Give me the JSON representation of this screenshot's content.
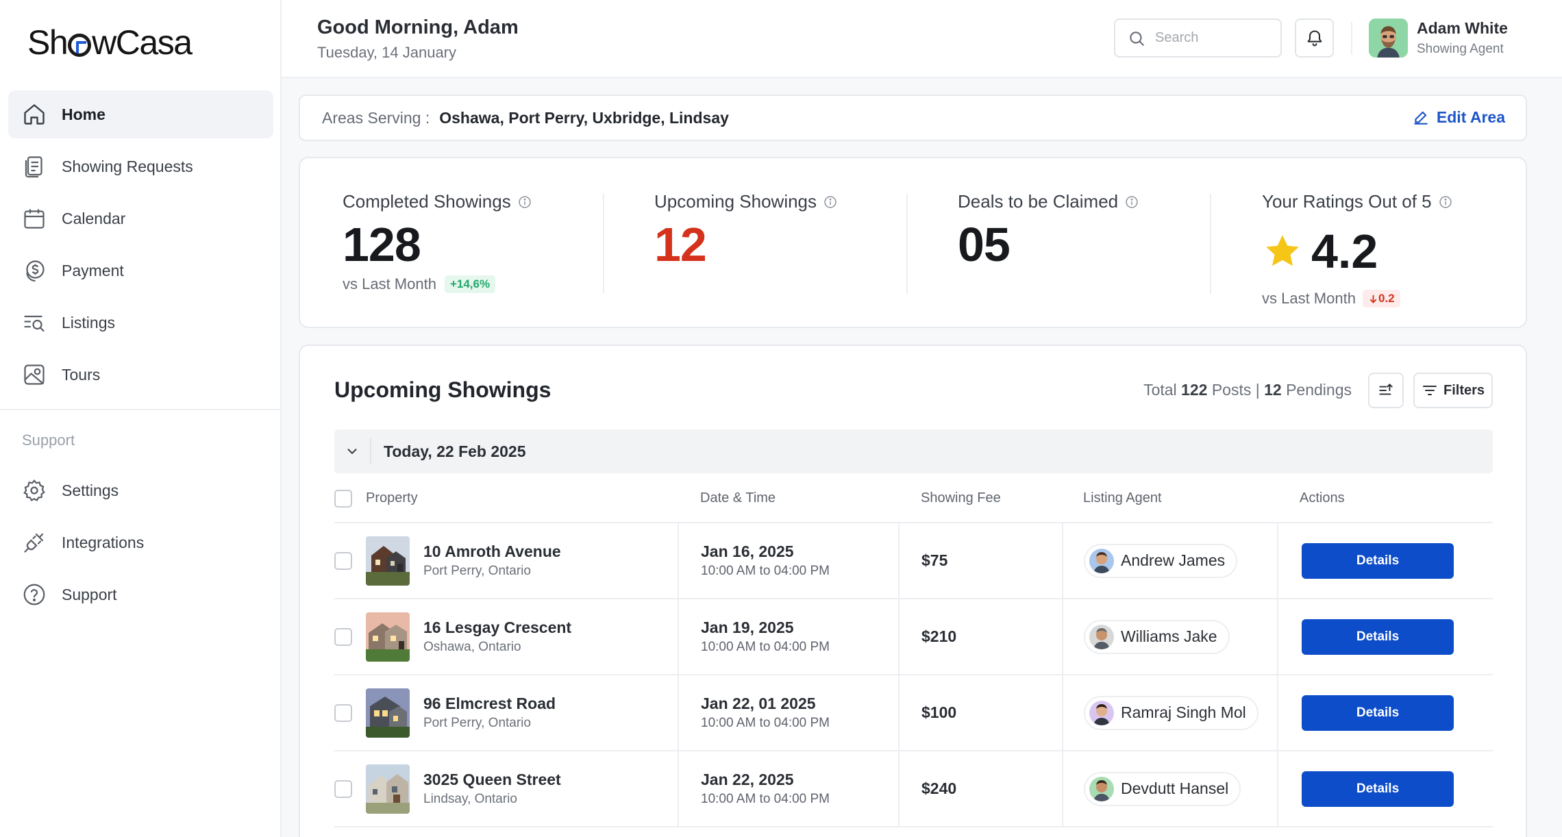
{
  "app": {
    "logo": "ShowCasa"
  },
  "sidebar": {
    "items": [
      {
        "label": "Home",
        "icon": "home-icon",
        "active": true
      },
      {
        "label": "Showing Requests",
        "icon": "document-icon"
      },
      {
        "label": "Calendar",
        "icon": "calendar-icon"
      },
      {
        "label": "Payment",
        "icon": "dollar-coin-icon"
      },
      {
        "label": "Listings",
        "icon": "list-search-icon"
      },
      {
        "label": "Tours",
        "icon": "map-pin-icon"
      }
    ],
    "section_label": "Support",
    "support_items": [
      {
        "label": "Settings",
        "icon": "gear-icon"
      },
      {
        "label": "Integrations",
        "icon": "plug-icon"
      },
      {
        "label": "Support",
        "icon": "help-circle-icon"
      }
    ]
  },
  "header": {
    "greeting": "Good Morning, Adam",
    "date": "Tuesday, 14 January",
    "search_placeholder": "Search",
    "user_name": "Adam White",
    "user_role": "Showing Agent"
  },
  "areas": {
    "label": "Areas Serving :",
    "value": "Oshawa, Port Perry, Uxbridge, Lindsay",
    "edit_label": "Edit Area"
  },
  "stats": {
    "completed": {
      "title": "Completed Showings",
      "value": "128",
      "compare": "vs Last Month",
      "change": "+14,6%"
    },
    "upcoming": {
      "title": "Upcoming Showings",
      "value": "12"
    },
    "deals": {
      "title": "Deals to be Claimed",
      "value": "05"
    },
    "rating": {
      "title": "Your Ratings Out of 5",
      "value": "4.2",
      "compare": "vs Last Month",
      "change": "0.2"
    }
  },
  "showings": {
    "title": "Upcoming Showings",
    "total_prefix": "Total",
    "total_count": "122",
    "total_posts_label": "Posts |",
    "pending_count": "12",
    "pending_label": "Pendings",
    "filters_label": "Filters",
    "group_label": "Today, 22 Feb 2025",
    "columns": [
      "Property",
      "Date & Time",
      "Showing Fee",
      "Listing Agent",
      "Actions"
    ],
    "action_label": "Details",
    "rows": [
      {
        "name": "10 Amroth Avenue",
        "location": "Port Perry, Ontario",
        "date": "Jan 16, 2025",
        "time": "10:00 AM to 04:00 PM",
        "fee": "$75",
        "agent": "Andrew James"
      },
      {
        "name": "16 Lesgay Crescent",
        "location": "Oshawa, Ontario",
        "date": "Jan 19, 2025",
        "time": "10:00 AM to 04:00 PM",
        "fee": "$210",
        "agent": "Williams Jake"
      },
      {
        "name": "96 Elmcrest Road",
        "location": "Port Perry, Ontario",
        "date": "Jan 22, 01 2025",
        "time": "10:00 AM to 04:00 PM",
        "fee": "$100",
        "agent": "Ramraj Singh Mol"
      },
      {
        "name": "3025 Queen Street",
        "location": "Lindsay, Ontario",
        "date": "Jan 22, 2025",
        "time": "10:00 AM to 04:00 PM",
        "fee": "$240",
        "agent": "Devdutt Hansel"
      }
    ]
  },
  "colors": {
    "primary": "#0d4dc9",
    "link": "#1d55c8",
    "upcoming_number": "#d5321b",
    "positive": "#24a86a",
    "negative": "#d5321b",
    "star": "#f5c518"
  }
}
